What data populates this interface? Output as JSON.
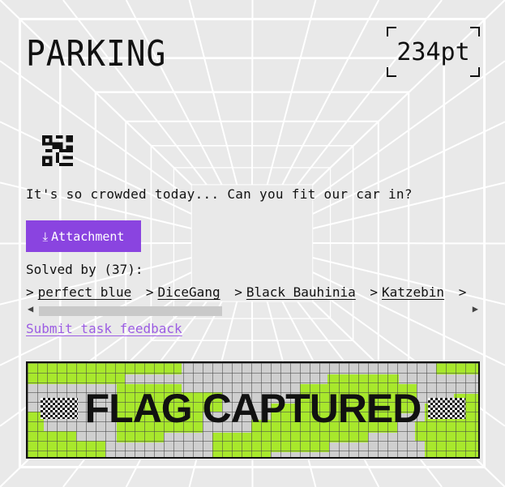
{
  "challenge": {
    "title": "PARKING",
    "points": "234pt",
    "icon": "qr-code-icon",
    "description": "It's so crowded today... Can you fit our car in?"
  },
  "attachment": {
    "icon": "download-arrow-icon",
    "arrow": "⤓",
    "label": "Attachment"
  },
  "solved": {
    "label": "Solved by (37):",
    "teams": [
      "perfect blue",
      "DiceGang",
      "Black Bauhinia",
      "Katzebin"
    ]
  },
  "feedback_link": "Submit task feedback",
  "banner": {
    "text": "FLAG CAPTURED",
    "accent": "#a8e82c"
  },
  "colors": {
    "accent": "#8a44e0",
    "link": "#9c5de3",
    "background": "#e9e9e9"
  }
}
